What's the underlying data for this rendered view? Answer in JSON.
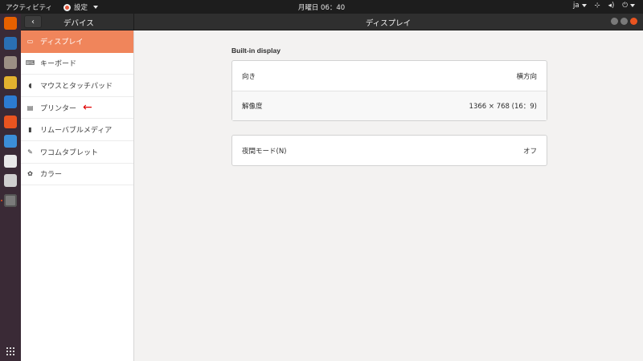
{
  "topbar": {
    "activities": "アクティビティ",
    "app_menu": "設定",
    "clock": "月曜日 06：40",
    "lang": "ja"
  },
  "dock": {
    "items": [
      {
        "icon": "firefox-icon",
        "color": "#e66000"
      },
      {
        "icon": "thunderbird-icon",
        "color": "#2a6fb4"
      },
      {
        "icon": "files-icon",
        "color": "#9c8f84"
      },
      {
        "icon": "rhythmbox-icon",
        "color": "#e2b12f"
      },
      {
        "icon": "libreoffice-writer-icon",
        "color": "#2c7bd1"
      },
      {
        "icon": "software-center-icon",
        "color": "#e95420"
      },
      {
        "icon": "help-icon",
        "color": "#3b8ed8"
      },
      {
        "icon": "amazon-icon",
        "color": "#e8e8e8"
      },
      {
        "icon": "screenshot-icon",
        "color": "#cfcfcf"
      },
      {
        "icon": "settings-icon",
        "color": "#7a7a7a"
      }
    ]
  },
  "header": {
    "section": "デバイス",
    "title": "ディスプレイ"
  },
  "sidebar": {
    "items": [
      {
        "label": "ディスプレイ",
        "icon": "display-icon",
        "glyph": "▭"
      },
      {
        "label": "キーボード",
        "icon": "keyboard-icon",
        "glyph": "⌨"
      },
      {
        "label": "マウスとタッチパッド",
        "icon": "mouse-icon",
        "glyph": "◖"
      },
      {
        "label": "プリンター",
        "icon": "printer-icon",
        "glyph": "▤"
      },
      {
        "label": "リムーバブルメディア",
        "icon": "removable-media-icon",
        "glyph": "▮"
      },
      {
        "label": "ワコムタブレット",
        "icon": "wacom-tablet-icon",
        "glyph": "✎"
      },
      {
        "label": "カラー",
        "icon": "color-icon",
        "glyph": "✿"
      }
    ],
    "arrow": "←"
  },
  "main": {
    "section_title": "Built-in display",
    "display_panel": {
      "orientation_label": "向き",
      "orientation_value": "横方向",
      "resolution_label": "解像度",
      "resolution_value": "1366 × 768 (16：9)"
    },
    "night_panel": {
      "night_label": "夜間モード(N)",
      "night_value": "オフ"
    }
  },
  "colors": {
    "accent": "#f0855b",
    "brand": "#e95420"
  }
}
